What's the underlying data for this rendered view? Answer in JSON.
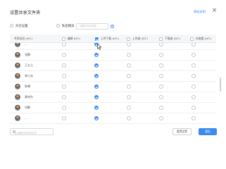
{
  "dialog": {
    "title": "设置共享文件夹",
    "help_link": "帮助说明",
    "close_glyph": "×"
  },
  "options": {
    "sync_label": "开启设置",
    "private_label": "私密模式",
    "name_placeholder": "设置文件夹名称",
    "info_glyph": "?"
  },
  "table": {
    "columns": [
      {
        "label": "共享成员 (N人)"
      },
      {
        "label": "编辑 (N人)"
      },
      {
        "label": "上传下载 (N人)"
      },
      {
        "label": "上传者 (N人)"
      },
      {
        "label": "下载者 (N人)"
      },
      {
        "label": "仅查看 (N人)"
      }
    ],
    "header_checked": [
      false,
      true,
      false,
      false,
      false
    ],
    "rows": [
      {
        "name": "...",
        "perm": 1
      },
      {
        "name": "张鹏",
        "perm": 1
      },
      {
        "name": "王五儿",
        "perm": 1
      },
      {
        "name": "林小丛",
        "perm": 1
      },
      {
        "name": "陈曦",
        "perm": 1
      },
      {
        "name": "秦哈东",
        "perm": 1
      },
      {
        "name": "刘鹏",
        "perm": 1
      },
      {
        "name": "...",
        "perm": 1
      }
    ]
  },
  "footer": {
    "search_placeholder": "搜索共享成员名字",
    "reset_label": "重置设置",
    "save_label": "保存"
  },
  "colors": {
    "accent": "#3d8bf2",
    "border": "#d9d9d9",
    "header_bg": "#f5f6f8"
  }
}
